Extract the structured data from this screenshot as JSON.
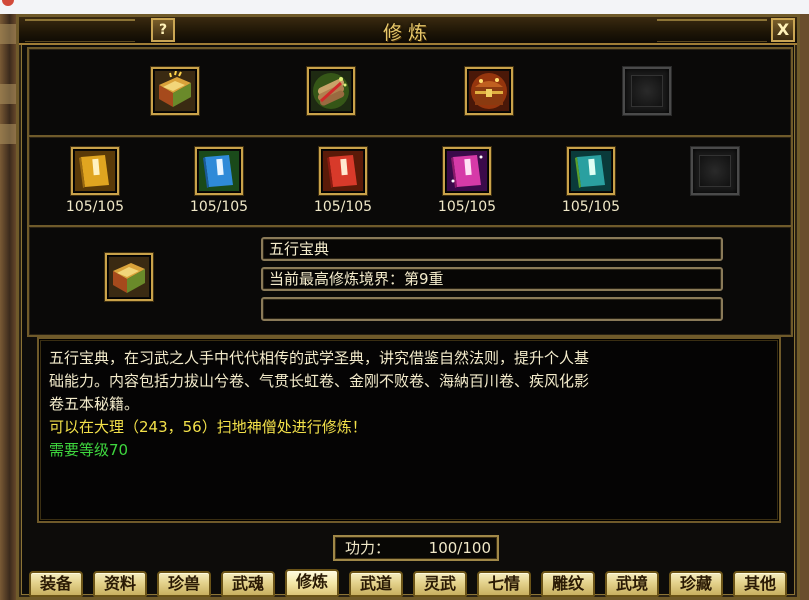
{
  "window": {
    "title": "修炼",
    "help_label": "?",
    "close_label": "X"
  },
  "top_row": {
    "items": [
      {
        "icon": "five-elements-book-icon"
      },
      {
        "icon": "scroll-bundle-icon"
      },
      {
        "icon": "treasure-chest-icon"
      },
      {
        "icon": "empty-slot-icon"
      }
    ]
  },
  "book_row": {
    "items": [
      {
        "icon": "yellow-manual-icon",
        "count": "105/105",
        "color": "#e0a520"
      },
      {
        "icon": "blue-manual-icon",
        "count": "105/105",
        "color": "#2f8ad8"
      },
      {
        "icon": "red-manual-icon",
        "count": "105/105",
        "color": "#d83a2a"
      },
      {
        "icon": "purple-manual-icon",
        "count": "105/105",
        "color": "#d63aa8"
      },
      {
        "icon": "cyan-manual-icon",
        "count": "105/105",
        "color": "#2aa0a0"
      },
      {
        "icon": "empty-slot-icon",
        "count": ""
      }
    ]
  },
  "detail": {
    "icon": "five-elements-book-icon",
    "name": "五行宝典",
    "realm": "当前最高修炼境界：第9重",
    "extra": ""
  },
  "description": {
    "lines": [
      "五行宝典，在习武之人手中代代相传的武学圣典，讲究借鉴自然法则，提升个人基",
      "础能力。内容包括力拔山兮卷、气贯长虹卷、金刚不败卷、海納百川卷、疾风化影",
      "卷五本秘籍。"
    ],
    "location": "可以在大理（243，56）扫地神僧处进行修炼！",
    "requirement": "需要等级70"
  },
  "power": {
    "label": "功力：",
    "value": "100/100"
  },
  "tabs": [
    {
      "label": "装备"
    },
    {
      "label": "资料"
    },
    {
      "label": "珍兽"
    },
    {
      "label": "武魂"
    },
    {
      "label": "修炼",
      "active": true
    },
    {
      "label": "武道"
    },
    {
      "label": "灵武"
    },
    {
      "label": "七情"
    },
    {
      "label": "雕纹"
    },
    {
      "label": "武境"
    },
    {
      "label": "珍藏"
    },
    {
      "label": "其他"
    }
  ],
  "colors": {
    "gold": "#c9a24a",
    "text_yellow": "#f3e14a",
    "text_green": "#3ed63e"
  }
}
